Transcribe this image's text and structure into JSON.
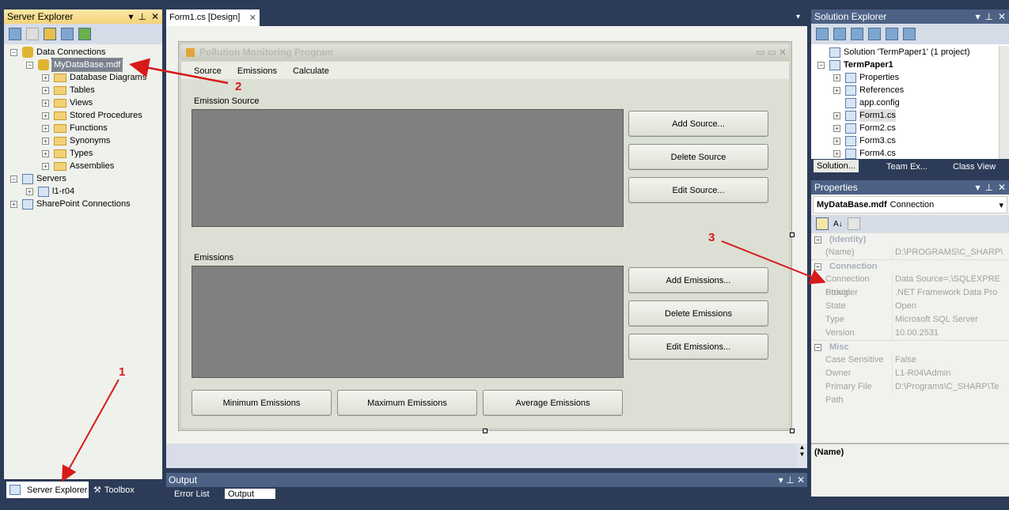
{
  "server_explorer": {
    "title": "Server Explorer",
    "tree": [
      {
        "label": "Data Connections",
        "level": 0,
        "expander": "−",
        "icon": "database-connections-icon"
      },
      {
        "label": "MyDataBase.mdf",
        "level": 1,
        "expander": "−",
        "icon": "database-icon",
        "selected": true
      },
      {
        "label": "Database Diagrams",
        "level": 2,
        "expander": "+",
        "icon": "folder-icon"
      },
      {
        "label": "Tables",
        "level": 2,
        "expander": "+",
        "icon": "folder-icon"
      },
      {
        "label": "Views",
        "level": 2,
        "expander": "+",
        "icon": "folder-icon"
      },
      {
        "label": "Stored Procedures",
        "level": 2,
        "expander": "+",
        "icon": "folder-icon"
      },
      {
        "label": "Functions",
        "level": 2,
        "expander": "+",
        "icon": "folder-icon"
      },
      {
        "label": "Synonyms",
        "level": 2,
        "expander": "+",
        "icon": "folder-icon"
      },
      {
        "label": "Types",
        "level": 2,
        "expander": "+",
        "icon": "folder-icon"
      },
      {
        "label": "Assemblies",
        "level": 2,
        "expander": "+",
        "icon": "folder-icon"
      },
      {
        "label": "Servers",
        "level": 0,
        "expander": "−",
        "icon": "servers-icon"
      },
      {
        "label": "l1-r04",
        "level": 1,
        "expander": "+",
        "icon": "computer-icon"
      },
      {
        "label": "SharePoint Connections",
        "level": 0,
        "expander": "+",
        "icon": "sharepoint-icon"
      }
    ],
    "bottom_tabs": [
      "Server Explorer",
      "Toolbox"
    ]
  },
  "designer": {
    "tab": "Form1.cs [Design]",
    "form": {
      "title": "Pollution Monitoring Program",
      "menu": [
        "Source",
        "Emissions",
        "Calculate"
      ],
      "emission_source_label": "Emission Source",
      "emissions_label": "Emissions",
      "source_buttons": [
        "Add Source...",
        "Delete Source",
        "Edit Source..."
      ],
      "emissions_buttons": [
        "Add Emissions...",
        "Delete Emissions",
        "Edit Emissions..."
      ],
      "bottom_buttons": [
        "Minimum Emissions",
        "Maximum Emissions",
        "Average Emissions"
      ]
    }
  },
  "output": {
    "title": "Output",
    "tabs": [
      "Error List",
      "Output"
    ]
  },
  "solution_explorer": {
    "title": "Solution Explorer",
    "items": [
      {
        "label": "Solution 'TermPaper1' (1 project)",
        "level": 0,
        "expander": ""
      },
      {
        "label": "TermPaper1",
        "level": 0,
        "expander": "−",
        "bold": true
      },
      {
        "label": "Properties",
        "level": 1,
        "expander": "+"
      },
      {
        "label": "References",
        "level": 1,
        "expander": "+"
      },
      {
        "label": "app.config",
        "level": 1,
        "expander": ""
      },
      {
        "label": "Form1.cs",
        "level": 1,
        "expander": "+",
        "selected": true
      },
      {
        "label": "Form2.cs",
        "level": 1,
        "expander": "+"
      },
      {
        "label": "Form3.cs",
        "level": 1,
        "expander": "+"
      },
      {
        "label": "Form4.cs",
        "level": 1,
        "expander": "+"
      }
    ],
    "bottom_tabs": [
      "Solution...",
      "Team Ex...",
      "Class View"
    ]
  },
  "properties": {
    "title": "Properties",
    "object_name": "MyDataBase.mdf",
    "object_type": "Connection",
    "categories": [
      {
        "name": "(Identity)",
        "rows": [
          [
            "(Name)",
            "D:\\PROGRAMS\\C_SHARP\\"
          ]
        ]
      },
      {
        "name": "Connection",
        "rows": [
          [
            "Connection String",
            "Data Source=.\\SQLEXPRE"
          ],
          [
            "Provider",
            ".NET Framework Data Pro"
          ],
          [
            "State",
            "Open"
          ],
          [
            "Type",
            "Microsoft SQL Server"
          ],
          [
            "Version",
            "10.00.2531"
          ]
        ]
      },
      {
        "name": "Misc",
        "rows": [
          [
            "Case Sensitive",
            "False"
          ],
          [
            "Owner",
            "L1-R04\\Admin"
          ],
          [
            "Primary File Path",
            "D:\\Programs\\C_SHARP\\Te"
          ]
        ]
      }
    ],
    "description_title": "(Name)"
  },
  "annotations": [
    "1",
    "2",
    "3"
  ],
  "colors": {
    "annotation": "#d61a1a",
    "ide_background": "#2c3b57"
  }
}
